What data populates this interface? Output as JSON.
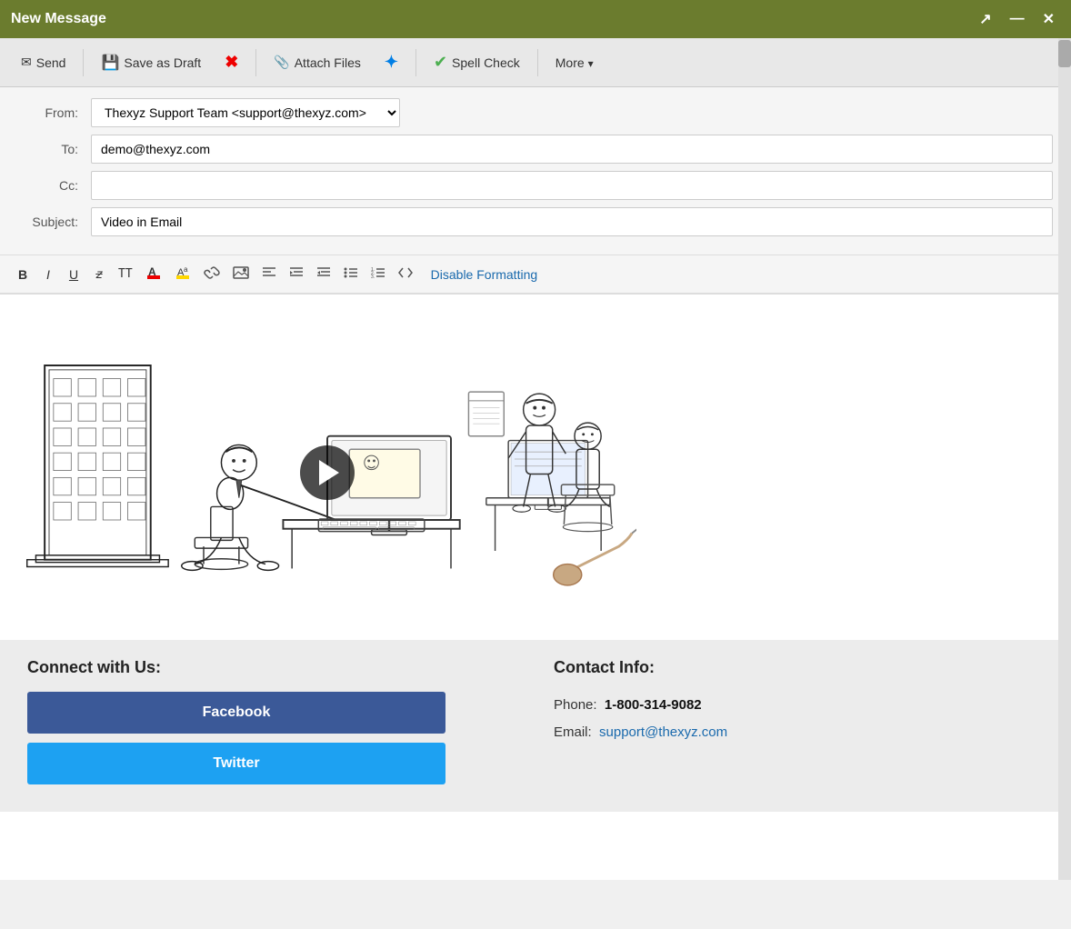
{
  "titleBar": {
    "title": "New Message",
    "controls": {
      "maximize": "🗗",
      "minimize": "—",
      "close": "✕"
    }
  },
  "toolbar": {
    "sendLabel": "Send",
    "saveLabel": "Save as Draft",
    "attachLabel": "Attach Files",
    "spellLabel": "Spell Check",
    "moreLabel": "More"
  },
  "form": {
    "fromLabel": "From:",
    "fromValue": "Thexyz Support Team <support@thexyz.com>",
    "toLabel": "To:",
    "toValue": "demo@thexyz.com",
    "ccLabel": "Cc:",
    "ccValue": "",
    "subjectLabel": "Subject:",
    "subjectValue": "Video in Email"
  },
  "formatBar": {
    "bold": "B",
    "italic": "I",
    "underline": "U",
    "strikethrough": "F",
    "monospace": "TT",
    "disableFormatting": "Disable Formatting"
  },
  "footer": {
    "connectTitle": "Connect with Us:",
    "contactTitle": "Contact Info:",
    "facebook": "Facebook",
    "twitter": "Twitter",
    "phoneLabel": "Phone:",
    "phoneValue": "1-800-314-9082",
    "emailLabel": "Email:",
    "emailValue": "support@thexyz.com"
  }
}
